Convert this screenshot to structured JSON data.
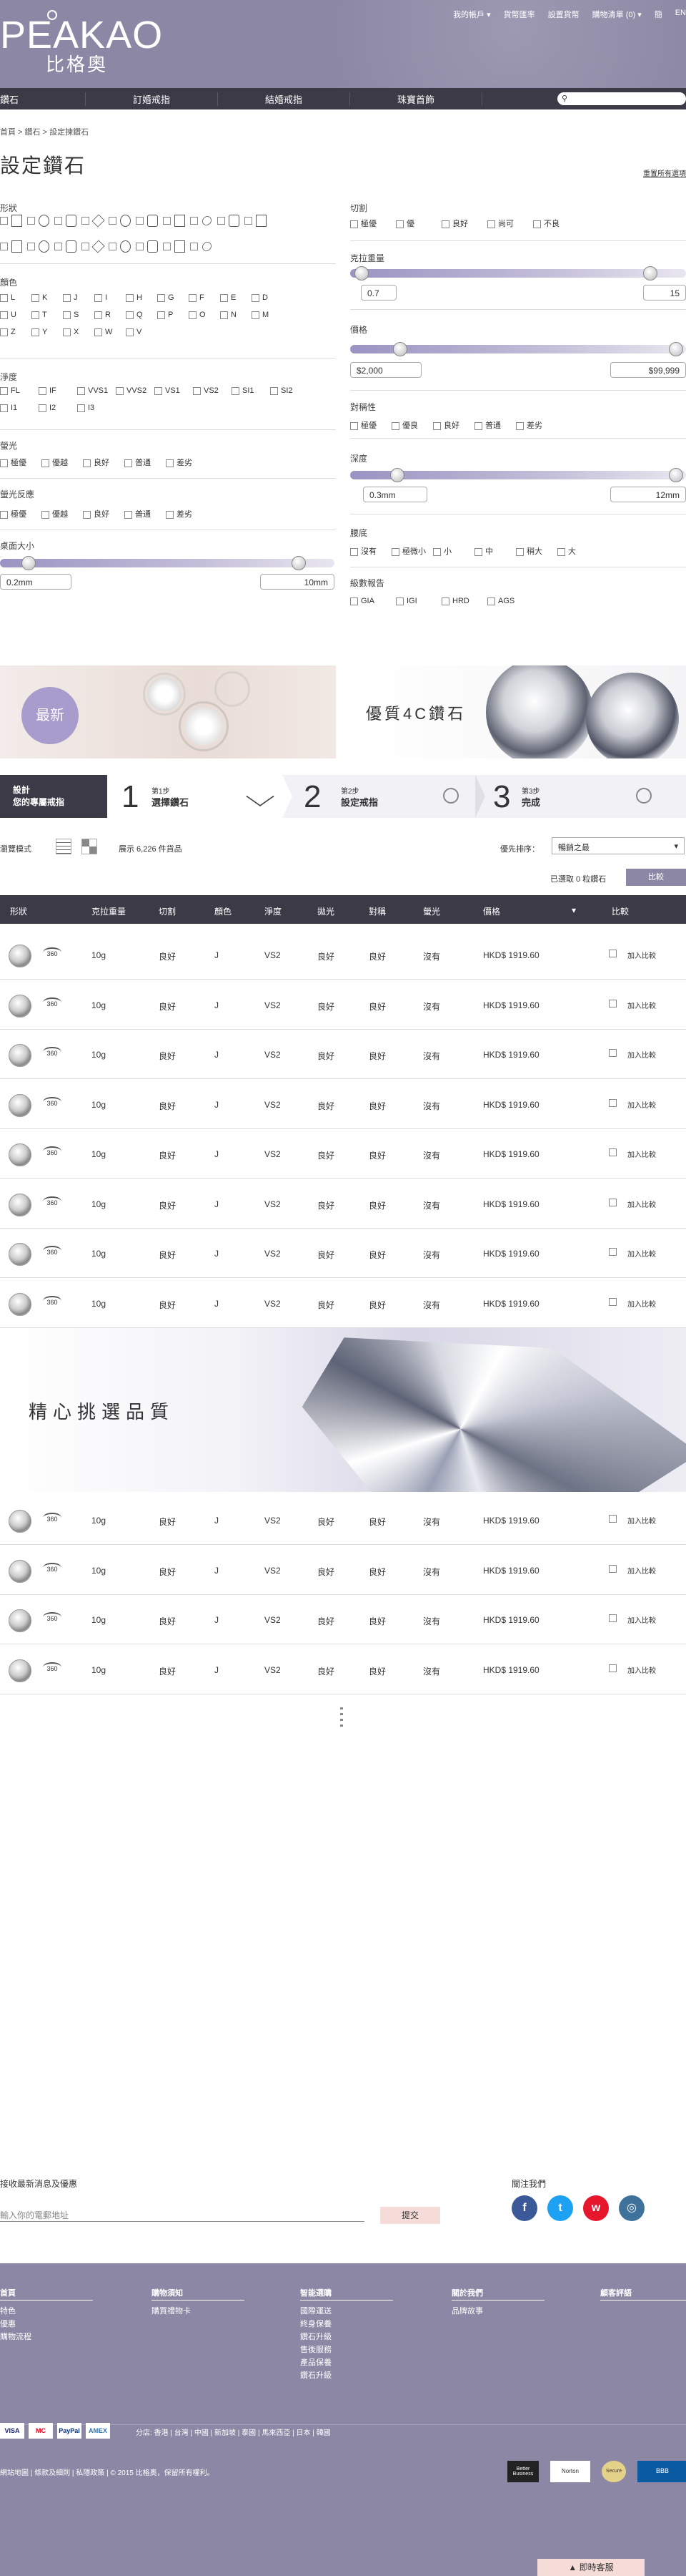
{
  "header": {
    "topnav": [
      "我的帳戶 ▾",
      "貨幣匯率",
      "設置貨幣",
      "購物清單 (0) ▾",
      "簡",
      "EN"
    ],
    "logo_en": "PEAKAO",
    "logo_zh": "比格奧"
  },
  "nav": [
    "鑽石",
    "訂婚戒指",
    "結婚戒指",
    "珠寶首飾"
  ],
  "crumb": "首頁 > 鑽石 > 設定揀鑽石",
  "title": "設定鑽石",
  "reset": "重置所有選項",
  "filters": {
    "shape": "形狀",
    "color": "顏色",
    "clarity": "淨度",
    "fluor": "螢光",
    "fluor2": "螢光反應",
    "table": "桌面大小",
    "cut": "切割",
    "carat": "克拉重量",
    "price": "價格",
    "symmetry": "對稱性",
    "depth": "深度",
    "girdle": "腰底",
    "report": "級數報告",
    "color_opts": [
      "L",
      "K",
      "J",
      "I",
      "H",
      "G",
      "F",
      "E",
      "D",
      "U",
      "T",
      "S",
      "R",
      "Q",
      "P",
      "O",
      "N",
      "M",
      "Z",
      "Y",
      "X",
      "W",
      "V"
    ],
    "clarity_opts": [
      "FL",
      "IF",
      "VVS1",
      "VVS2",
      "VS1",
      "VS2",
      "SI1",
      "SI2",
      "I1",
      "I2",
      "I3"
    ],
    "grade5": [
      "極優",
      "優",
      "良好",
      "尚可",
      "不良"
    ],
    "grade5b": [
      "極優",
      "優越",
      "良好",
      "普通",
      "差劣"
    ],
    "sym5": [
      "極優",
      "優良",
      "良好",
      "普通",
      "差劣"
    ],
    "girdle_opts": [
      "沒有",
      "極微小",
      "小",
      "中",
      "稍大",
      "大"
    ],
    "report_opts": [
      "GIA",
      "IGI",
      "HRD",
      "AGS"
    ],
    "carat_min": "0.7",
    "carat_max": "15",
    "price_min": "$2,000",
    "price_max": "$99,999",
    "depth_min": "0.3mm",
    "depth_max": "12mm",
    "table_min": "0.2mm",
    "table_max": "10mm"
  },
  "banner": {
    "new": "最新",
    "quality": "優質4C鑽石",
    "select": "精心挑選品質"
  },
  "steps": {
    "intro_1": "設計",
    "intro_2": "您的專屬戒指",
    "s1n": "1",
    "s1a": "第1步",
    "s1b": "選擇鑽石",
    "s2n": "2",
    "s2a": "第2步",
    "s2b": "設定戒指",
    "s3n": "3",
    "s3a": "第3步",
    "s3b": "完成"
  },
  "list": {
    "view": "瀏覽模式",
    "count": "展示 6,226 件貨品",
    "sortlabel": "優先排序：",
    "sortval": "暢銷之最",
    "selected": "已選取 0 粒鑽石",
    "compare": "比較"
  },
  "table": {
    "cols": [
      "形狀",
      "克拉重量",
      "切割",
      "顏色",
      "淨度",
      "拋光",
      "對稱",
      "螢光",
      "價格",
      "▾",
      "比較"
    ],
    "row": [
      "10g",
      "良好",
      "J",
      "VS2",
      "良好",
      "良好",
      "沒有",
      "HKD$ 1919.60",
      "加入比較"
    ],
    "v360": "360"
  },
  "newsletter": {
    "title": "接收最新消息及優惠",
    "placeholder": "輸入你的電郵地址",
    "submit": "提交",
    "follow": "關注我們"
  },
  "footer": {
    "cols": [
      {
        "h": "首頁",
        "items": [
          "特色",
          "優惠",
          "購物流程"
        ]
      },
      {
        "h": "購物須知",
        "items": [
          "購買禮物卡"
        ]
      },
      {
        "h": "智能選購",
        "items": [
          "國際運送",
          "終身保養",
          "鑽石升級",
          "售後服務",
          "產品保養",
          "鑽石升級"
        ]
      },
      {
        "h": "關於我們",
        "items": [
          "品牌故事"
        ]
      },
      {
        "h": "顧客評語",
        "items": []
      }
    ],
    "regions": "分店: 香港 | 台灣 | 中國 | 新加坡 | 泰國 | 馬來西亞 | 日本 | 韓國",
    "bottom": "網站地圖 | 條款及細則 | 私隱政策 | © 2015 比格奧，保留所有權利。",
    "cards": [
      "VISA",
      "MC",
      "PayPal",
      "AMEX"
    ],
    "badges": [
      "Better Business",
      "Norton",
      "Secure",
      "BBB"
    ],
    "chat": "▲ 即時客服"
  },
  "colors": {
    "brand": "#8c87a4",
    "dark": "#3d3a47",
    "accent": "#a69ccc"
  }
}
